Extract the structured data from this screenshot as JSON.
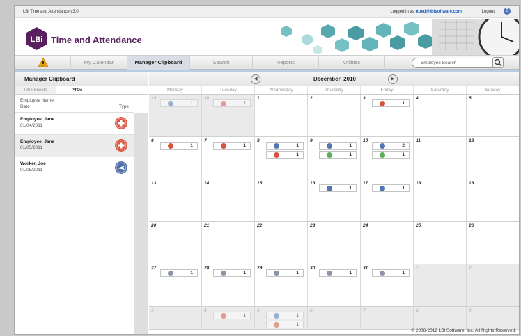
{
  "topbar": {
    "app_name": "LBi Time and Attendance v3.0",
    "logged_in_label": "Logged in as",
    "username": "rtoed@lbisoftware.com",
    "logout": "Logout",
    "help": "?"
  },
  "banner": {
    "logo_text": "LBi",
    "title": "Time and Attendance"
  },
  "nav": {
    "tabs": [
      "My Calendar",
      "Manager Clipboard",
      "Search",
      "Reports",
      "Utilities"
    ],
    "active": "Manager Clipboard",
    "search_placeholder": "- Employee Search -"
  },
  "left_panel": {
    "title": "Manager Clipboard",
    "tabs": [
      "Time Sheets",
      "PTOs"
    ],
    "active_tab": "PTOs",
    "col_name": "Employee Name",
    "col_date": "Date",
    "col_type": "Type",
    "rows": [
      {
        "name": "Employee, Jane",
        "date": "01/04/2011",
        "icon": "plus-icon",
        "color": "#d9533c"
      },
      {
        "name": "Employee, Jane",
        "date": "01/05/2011",
        "icon": "plus-icon",
        "color": "#d9533c"
      },
      {
        "name": "Worker, Joe",
        "date": "01/05/2011",
        "icon": "plane-icon",
        "color": "#4f6fa6"
      }
    ]
  },
  "calendar": {
    "month": "December",
    "year": "2010",
    "days": [
      "Monday",
      "Tuesday",
      "Wednesday",
      "Thursday",
      "Friday",
      "Saturday",
      "Sunday"
    ],
    "colors": {
      "plane": "#4f77b7",
      "plus": "#d9533c",
      "green": "#58b05a",
      "gray": "#8a93a8"
    },
    "weeks": [
      [
        {
          "n": "29",
          "out": true,
          "ev": [
            {
              "t": "plane",
              "c": "1"
            }
          ]
        },
        {
          "n": "30",
          "out": true,
          "ev": [
            {
              "t": "plus",
              "c": "2"
            }
          ]
        },
        {
          "n": "1",
          "ev": []
        },
        {
          "n": "2",
          "ev": []
        },
        {
          "n": "3",
          "ev": [
            {
              "t": "plus",
              "c": "1"
            }
          ]
        },
        {
          "n": "4",
          "ev": []
        },
        {
          "n": "5",
          "ev": []
        }
      ],
      [
        {
          "n": "6",
          "ev": [
            {
              "t": "plus",
              "c": "1"
            }
          ]
        },
        {
          "n": "7",
          "ev": [
            {
              "t": "plus",
              "c": "1"
            }
          ]
        },
        {
          "n": "8",
          "ev": [
            {
              "t": "plane",
              "c": "1"
            },
            {
              "t": "plus",
              "c": "1"
            }
          ]
        },
        {
          "n": "9",
          "ev": [
            {
              "t": "plane",
              "c": "1"
            },
            {
              "t": "green",
              "c": "1"
            }
          ]
        },
        {
          "n": "10",
          "ev": [
            {
              "t": "plane",
              "c": "2"
            },
            {
              "t": "green",
              "c": "1"
            }
          ]
        },
        {
          "n": "11",
          "ev": []
        },
        {
          "n": "12",
          "ev": []
        }
      ],
      [
        {
          "n": "13",
          "ev": []
        },
        {
          "n": "14",
          "ev": []
        },
        {
          "n": "15",
          "ev": []
        },
        {
          "n": "16",
          "ev": [
            {
              "t": "plane",
              "c": "1"
            }
          ]
        },
        {
          "n": "17",
          "ev": [
            {
              "t": "plane",
              "c": "1"
            }
          ]
        },
        {
          "n": "18",
          "ev": []
        },
        {
          "n": "19",
          "ev": []
        }
      ],
      [
        {
          "n": "20",
          "ev": []
        },
        {
          "n": "21",
          "ev": []
        },
        {
          "n": "22",
          "ev": []
        },
        {
          "n": "23",
          "ev": []
        },
        {
          "n": "24",
          "ev": []
        },
        {
          "n": "25",
          "ev": []
        },
        {
          "n": "26",
          "ev": []
        }
      ],
      [
        {
          "n": "27",
          "ev": [
            {
              "t": "gray",
              "c": "1"
            }
          ]
        },
        {
          "n": "28",
          "ev": [
            {
              "t": "gray",
              "c": "1"
            }
          ]
        },
        {
          "n": "29",
          "ev": [
            {
              "t": "gray",
              "c": "1"
            }
          ]
        },
        {
          "n": "30",
          "ev": [
            {
              "t": "gray",
              "c": "1"
            }
          ]
        },
        {
          "n": "31",
          "ev": [
            {
              "t": "gray",
              "c": "1"
            }
          ]
        },
        {
          "n": "1",
          "out": true,
          "ev": []
        },
        {
          "n": "2",
          "out": true,
          "ev": []
        }
      ],
      [
        {
          "n": "3",
          "out": true,
          "ev": []
        },
        {
          "n": "4",
          "out": true,
          "ev": [
            {
              "t": "plus",
              "c": "1"
            }
          ]
        },
        {
          "n": "5",
          "out": true,
          "ev": [
            {
              "t": "plane",
              "c": "1"
            },
            {
              "t": "plus",
              "c": "1"
            }
          ]
        },
        {
          "n": "6",
          "out": true,
          "ev": []
        },
        {
          "n": "7",
          "out": true,
          "ev": []
        },
        {
          "n": "8",
          "out": true,
          "ev": []
        },
        {
          "n": "9",
          "out": true,
          "ev": []
        }
      ]
    ]
  },
  "footer": {
    "copyright": "© 2006-2012 LBi Software, Inc. All Rights Reserved."
  }
}
